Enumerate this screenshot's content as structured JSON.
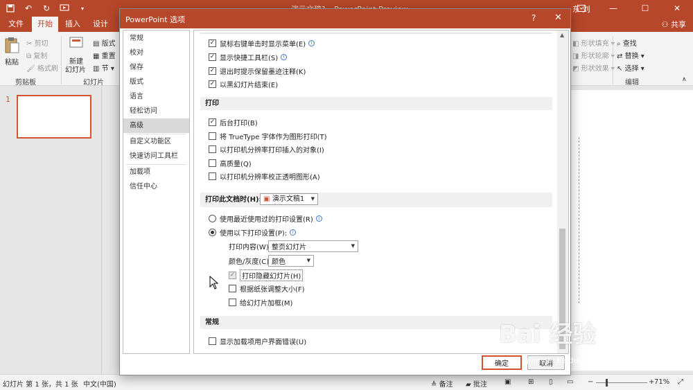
{
  "titlebar": {
    "title": "演示文稿1 - PowerPoint Preview",
    "user": "东 刘",
    "qat_icons": [
      "save-icon",
      "undo-icon",
      "redo-icon",
      "start-from-beginning-icon",
      "customize-qat-icon"
    ],
    "window_controls": [
      "ribbon-display-icon",
      "minimize-icon",
      "maximize-icon",
      "close-icon"
    ]
  },
  "tabs": [
    "文件",
    "开始",
    "插入",
    "设计"
  ],
  "active_tab": "开始",
  "share_label": "共享",
  "ribbon": {
    "paste": "粘贴",
    "cut": "剪切",
    "copy": "复制",
    "format_painter": "格式刷",
    "clipboard_group": "剪贴板",
    "new_slide": "新建",
    "new_slide_2": "幻灯片",
    "layout": "版式",
    "reset": "重置",
    "section": "节",
    "slides_group": "幻灯片",
    "shape_fill": "形状填充",
    "shape_outline": "形状轮廓",
    "shape_effects": "形状效果",
    "find": "查找",
    "replace": "替换",
    "select": "选择",
    "editing_group": "编辑"
  },
  "thumbnail_number": "1",
  "dialog": {
    "title": "PowerPoint 选项",
    "help": "?",
    "close": "✕",
    "nav": [
      "常规",
      "校对",
      "保存",
      "版式",
      "语言",
      "轻松访问",
      "高级",
      "自定义功能区",
      "快速访问工具栏",
      "加载项",
      "信任中心"
    ],
    "selected_nav": "高级",
    "top_options": [
      {
        "label": "鼠标右键单击时显示菜单(E)",
        "checked": true,
        "info": true
      },
      {
        "label": "显示快捷工具栏(S)",
        "checked": true,
        "info": true
      },
      {
        "label": "退出时提示保留墨迹注释(K)",
        "checked": true,
        "info": false
      },
      {
        "label": "以黑幻灯片结束(E)",
        "checked": true,
        "info": false
      }
    ],
    "print_section": "打印",
    "print_options": [
      {
        "label": "后台打印(B)",
        "checked": true
      },
      {
        "label": "将 TrueType 字体作为图形打印(T)",
        "checked": false
      },
      {
        "label": "以打印机分辨率打印插入的对象(I)",
        "checked": false
      },
      {
        "label": "高质量(Q)",
        "checked": false
      },
      {
        "label": "以打印机分辨率校正透明图形(A)",
        "checked": false
      }
    ],
    "print_doc_label": "打印此文档时(H):",
    "print_doc_value": "演示文稿1",
    "radio_recent": "使用最近使用过的打印设置(R)",
    "radio_following": "使用以下打印设置(P):",
    "print_what_label": "打印内容(W):",
    "print_what_value": "整页幻灯片",
    "color_label": "颜色/灰度(C):",
    "color_value": "颜色",
    "sub_options": [
      {
        "label": "打印隐藏幻灯片(H)",
        "checked": true,
        "disabled": true
      },
      {
        "label": "根据纸张调整大小(F)",
        "checked": false,
        "disabled": false
      },
      {
        "label": "给幻灯片加框(M)",
        "checked": false,
        "disabled": false
      }
    ],
    "general_section": "常规",
    "general_options": [
      {
        "label": "显示加载项用户界面错误(U)",
        "checked": false
      }
    ],
    "ok": "确定",
    "cancel": "取消"
  },
  "statusbar": {
    "slide_info": "幻灯片 第 1 张，共 1 张",
    "language": "中文(中国)",
    "notes": "备注",
    "comments": "批注",
    "zoom": "71%"
  },
  "watermark": {
    "logo": "Bai 经验",
    "url": "jingyan.baidu.com"
  },
  "colors": {
    "accent": "#b7472a",
    "accent_light": "#d35230"
  }
}
